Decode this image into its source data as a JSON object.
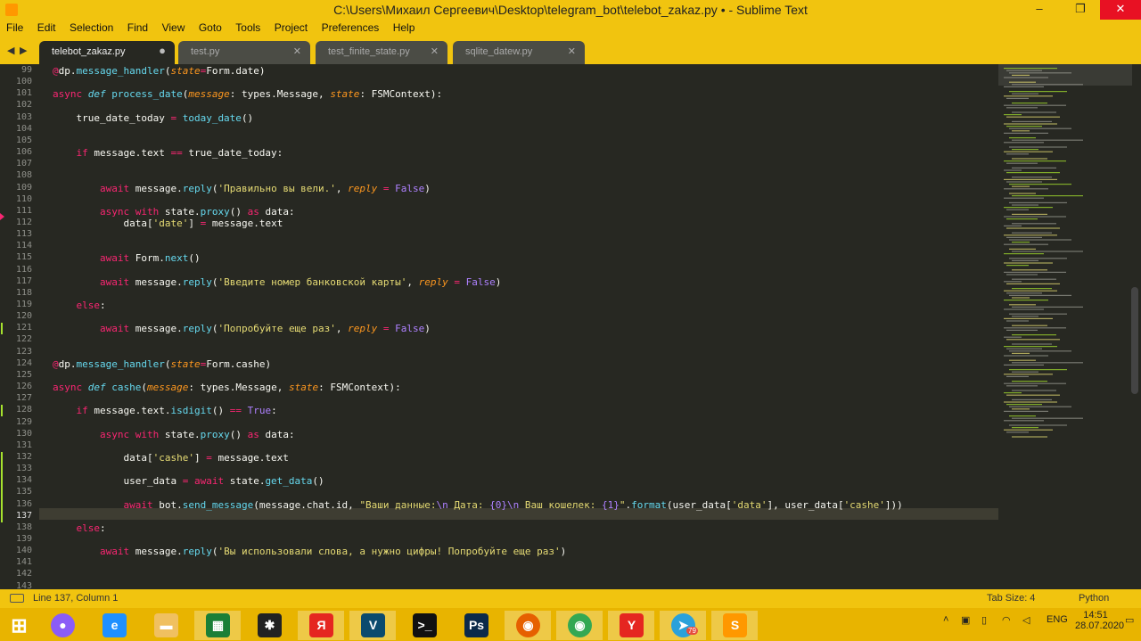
{
  "window": {
    "title": "C:\\Users\\Михаил Сергеевич\\Desktop\\telegram_bot\\telebot_zakaz.py • - Sublime Text",
    "minimize": "–",
    "restore": "❐",
    "close": "✕"
  },
  "menu": [
    "File",
    "Edit",
    "Selection",
    "Find",
    "View",
    "Goto",
    "Tools",
    "Project",
    "Preferences",
    "Help"
  ],
  "tabs": [
    {
      "label": "telebot_zakaz.py",
      "close": "●"
    },
    {
      "label": "test.py",
      "close": "✕"
    },
    {
      "label": "test_finite_state.py",
      "close": "✕"
    },
    {
      "label": "sqlite_datew.py",
      "close": "✕"
    }
  ],
  "nav": {
    "back": "◀",
    "forward": "▶"
  },
  "editor": {
    "line_numbers": [
      "99",
      "100",
      "101",
      "102",
      "103",
      "104",
      "105",
      "106",
      "107",
      "108",
      "109",
      "110",
      "111",
      "112",
      "113",
      "114",
      "115",
      "116",
      "117",
      "118",
      "119",
      "120",
      "121",
      "122",
      "123",
      "124",
      "125",
      "126",
      "127",
      "128",
      "129",
      "130",
      "131",
      "132",
      "133",
      "134",
      "135",
      "136",
      "137",
      "138",
      "139",
      "140",
      "141",
      "142",
      "143"
    ],
    "code": [
      "@dp.message_handler(state=Form.date)",
      "",
      "async def process_date(message: types.Message, state: FSMContext):",
      "",
      "    true_date_today = today_date()",
      "",
      "",
      "    if message.text == true_date_today:",
      "",
      "",
      "        await message.reply('Правильно вы вели.', reply = False)",
      "",
      "        async with state.proxy() as data:",
      "            data['date'] = message.text",
      "",
      "",
      "        await Form.next()",
      "",
      "        await message.reply('Введите номер банковской карты', reply = False)",
      "",
      "    else:",
      "",
      "        await message.reply('Попробуйте еще раз', reply = False)",
      "",
      "",
      "@dp.message_handler(state=Form.cashe)",
      "",
      "async def cashe(message: types.Message, state: FSMContext):",
      "",
      "    if message.text.isdigit() == True:",
      "",
      "        async with state.proxy() as data:",
      "",
      "            data['cashe'] = message.text",
      "",
      "            user_data = await state.get_data()",
      "",
      "            await bot.send_message(message.chat.id, \"Ваши данные:\\n Дата: {0}\\n Ваш кошелек: {1}\".format(user_data['data'], user_data['cashe']))",
      "",
      "    else:",
      "",
      "        await message.reply('Вы использовали слова, а нужно цифры! Попробуйте еще раз')",
      "",
      "",
      ""
    ]
  },
  "status": {
    "position": "Line 137, Column 1",
    "tab_size": "Tab Size: 4",
    "syntax": "Python"
  },
  "taskbar": {
    "items": [
      {
        "name": "windows-start",
        "glyph": "⊞",
        "color": "#e8b400"
      },
      {
        "name": "alice-assistant",
        "glyph": "●",
        "color": "#8b5cf6"
      },
      {
        "name": "internet-explorer",
        "glyph": "e",
        "color": "#1e90ff"
      },
      {
        "name": "file-explorer",
        "glyph": "▬",
        "color": "#f0c060"
      },
      {
        "name": "store",
        "glyph": "▦",
        "color": "#1a7f37"
      },
      {
        "name": "game-app",
        "glyph": "✱",
        "color": "#222222"
      },
      {
        "name": "yandex-browser",
        "glyph": "Я",
        "color": "#e52620"
      },
      {
        "name": "vs-app",
        "glyph": "V",
        "color": "#0b4a6e"
      },
      {
        "name": "command-prompt",
        "glyph": ">_",
        "color": "#111111"
      },
      {
        "name": "photoshop",
        "glyph": "Ps",
        "color": "#0b2a4a"
      },
      {
        "name": "firefox",
        "glyph": "◉",
        "color": "#e66000"
      },
      {
        "name": "chrome",
        "glyph": "◉",
        "color": "#34a853"
      },
      {
        "name": "yandex",
        "glyph": "Y",
        "color": "#e52620"
      },
      {
        "name": "telegram",
        "glyph": "➤",
        "color": "#2aa1da"
      },
      {
        "name": "sublime-text",
        "glyph": "S",
        "color": "#ff9800"
      }
    ],
    "telegram_badge": "79",
    "lang": "ENG",
    "time": "14:51",
    "date": "28.07.2020"
  }
}
